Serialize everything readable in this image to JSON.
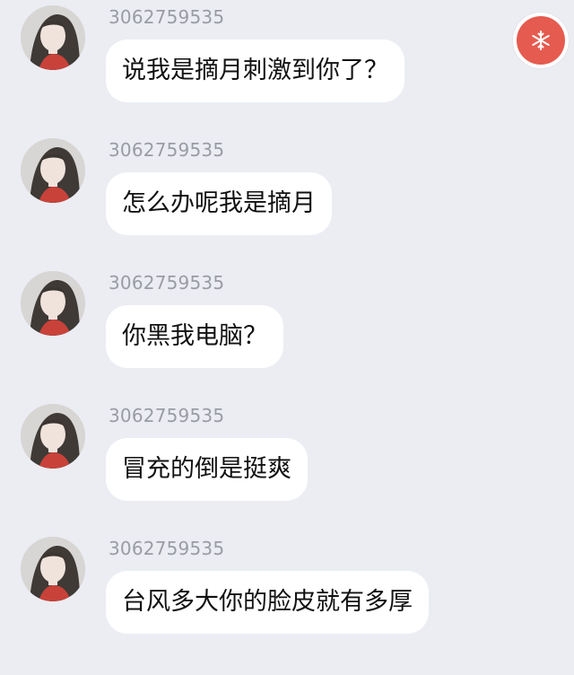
{
  "messages": [
    {
      "sender": "3062759535",
      "text": "说我是摘月刺激到你了？"
    },
    {
      "sender": "3062759535",
      "text": "怎么办呢我是摘月"
    },
    {
      "sender": "3062759535",
      "text": "你黑我电脑？"
    },
    {
      "sender": "3062759535",
      "text": "冒充的倒是挺爽"
    },
    {
      "sender": "3062759535",
      "text": "台风多大你的脸皮就有多厚"
    }
  ],
  "colors": {
    "background": "#ebedf3",
    "bubble": "#ffffff",
    "sender_text": "#9a9ca3",
    "message_text": "#111111",
    "fab_accent": "#e55b4f"
  },
  "icons": {
    "avatar": "user-avatar",
    "fab": "snowflake-icon"
  }
}
